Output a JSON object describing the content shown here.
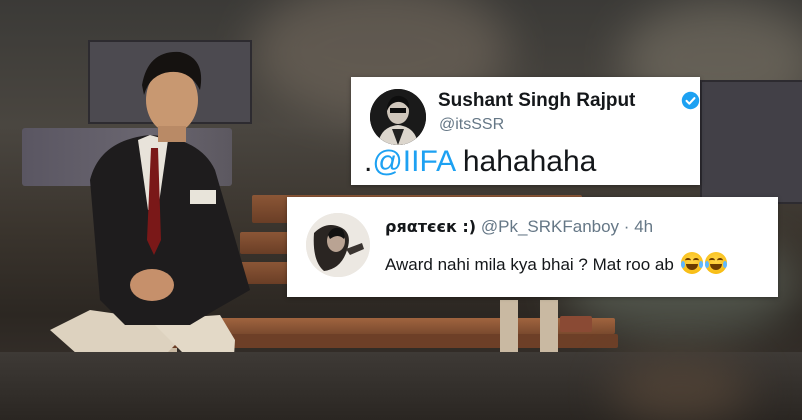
{
  "tweet_primary": {
    "name": "Sushant Singh Rajput",
    "handle": "@itsSSR",
    "text_prefix": ".",
    "mention": "@IIFA",
    "text_suffix": " hahahaha",
    "verified": true,
    "verified_color": "#1da1f2"
  },
  "tweet_reply": {
    "name": "ρяαтєєк :)",
    "handle": "@Pk_SRKFanboy",
    "separator": "·",
    "time": "4h",
    "text": "Award nahi mila kya bhai ? Mat roo ab ",
    "emojis": [
      "face-with-tears-of-joy",
      "face-with-tears-of-joy"
    ]
  },
  "colors": {
    "link": "#1da1f2",
    "secondary_text": "#657786",
    "primary_text": "#14171a",
    "bench": "#7a4a2e"
  }
}
